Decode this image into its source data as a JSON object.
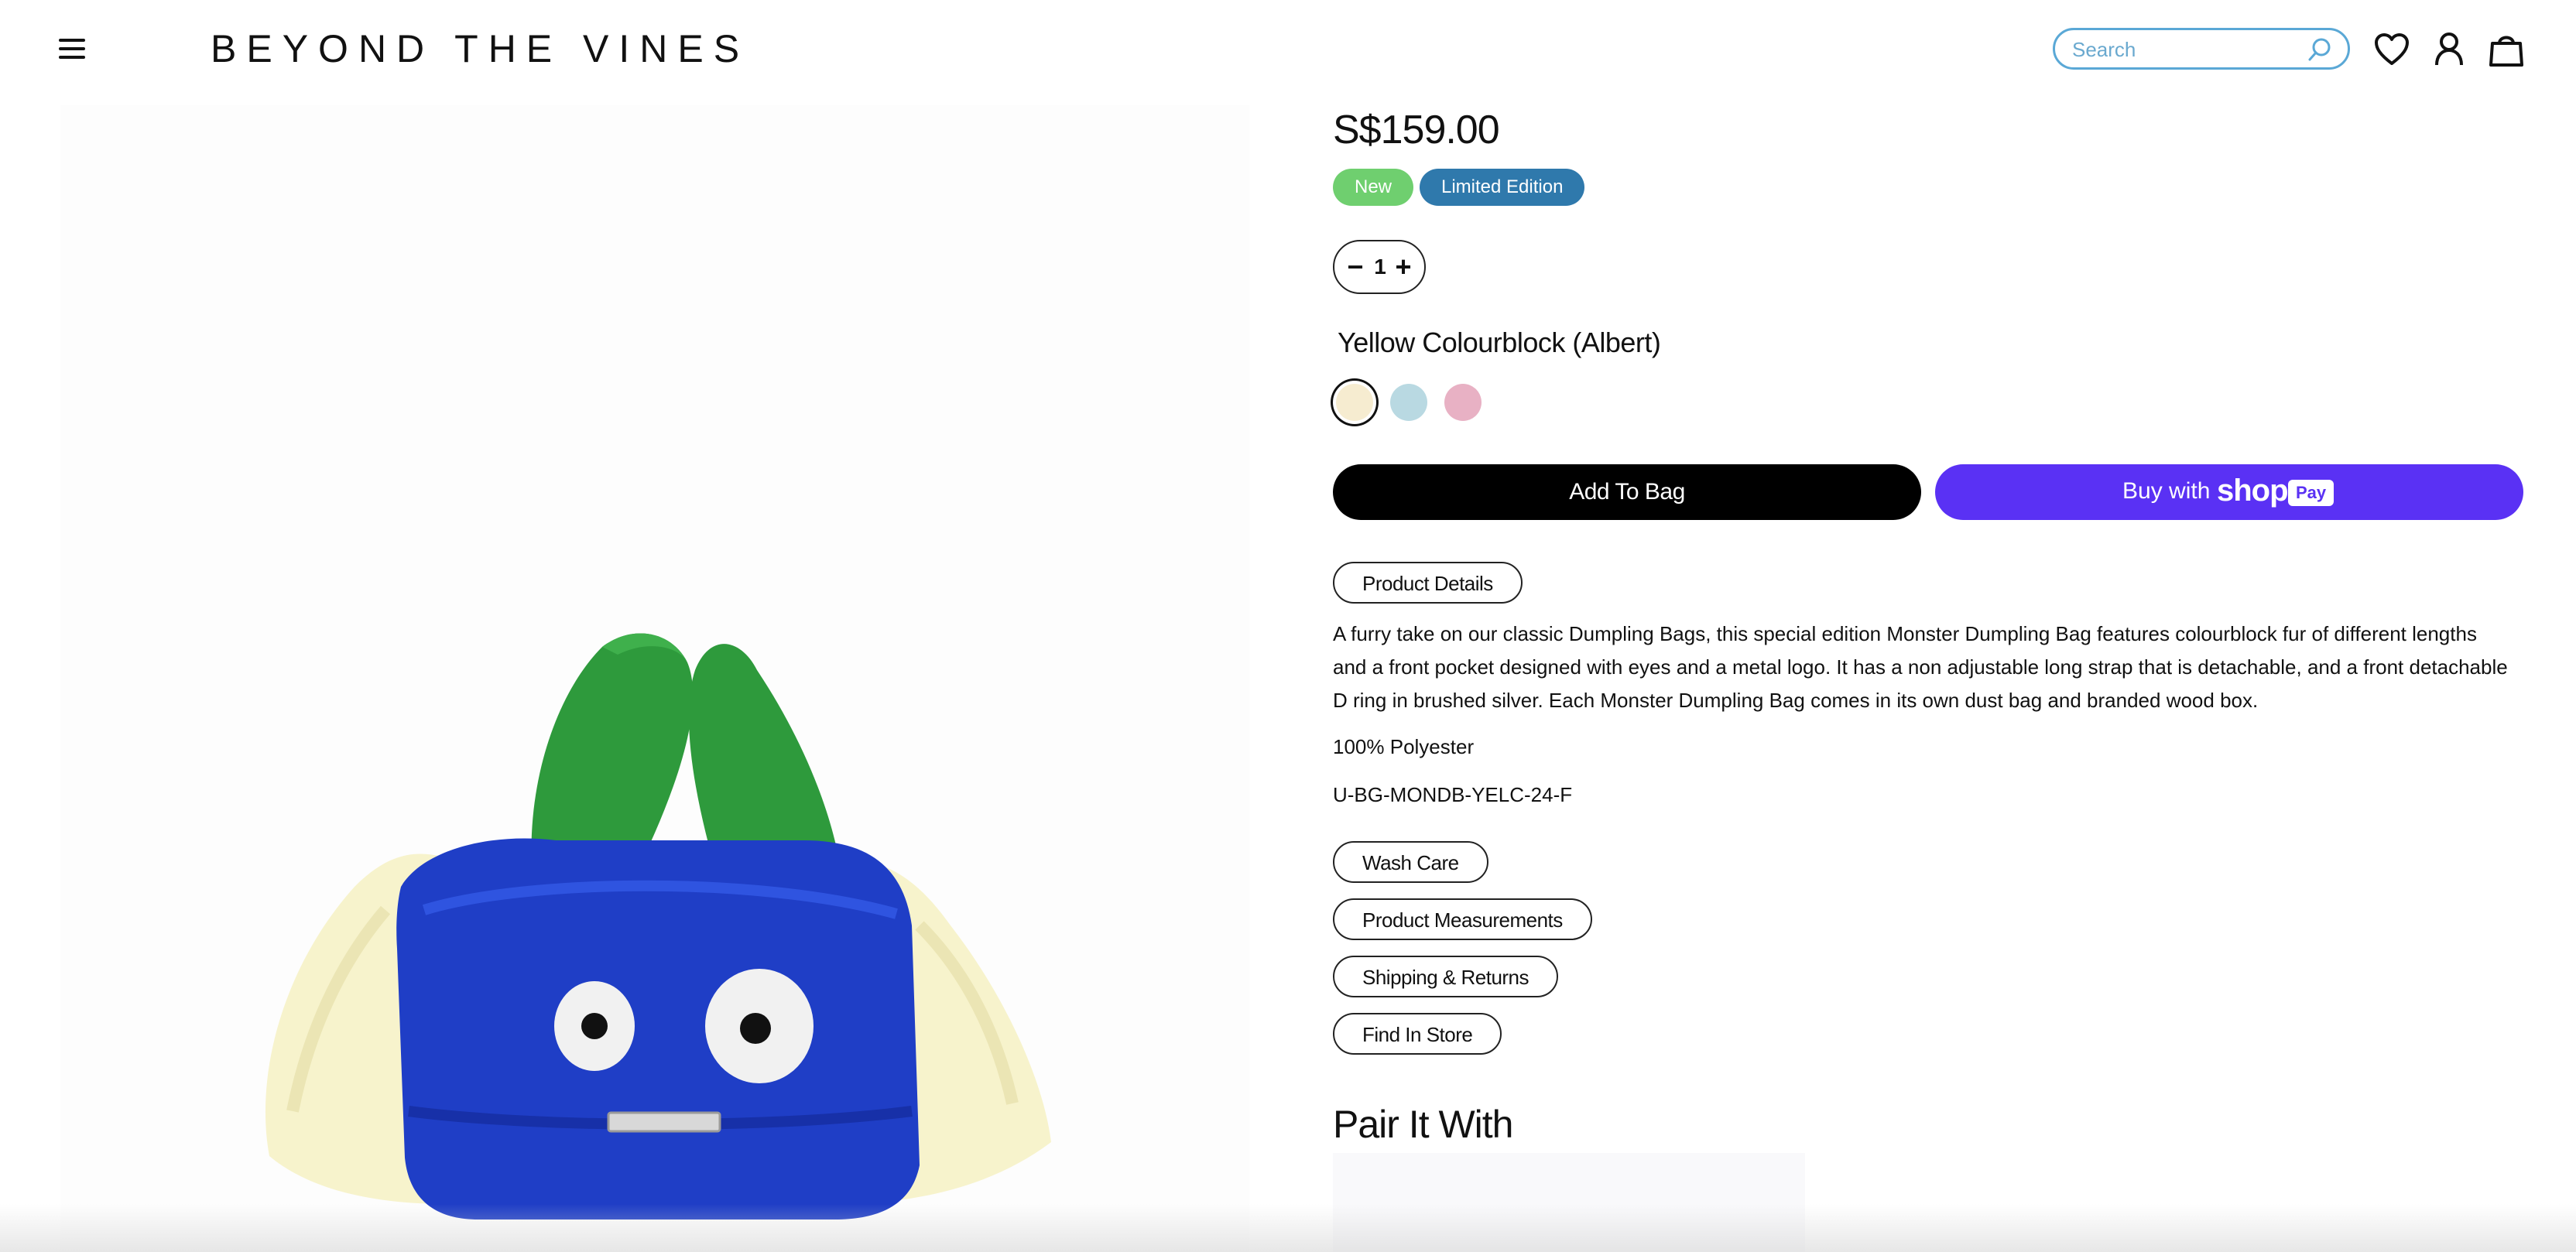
{
  "header": {
    "logo": "BEYOND THE VINES",
    "search_placeholder": "Search",
    "icons": [
      "menu-icon",
      "search-icon",
      "heart-icon",
      "account-icon",
      "bag-icon"
    ]
  },
  "product": {
    "price": "S$159.00",
    "badges": [
      "New",
      "Limited Edition"
    ],
    "quantity": "1",
    "variant_name": "Yellow Colourblock (Albert)",
    "swatches": [
      {
        "color": "#f6ecd0",
        "selected": true
      },
      {
        "color": "#b9d9e2",
        "selected": false
      },
      {
        "color": "#e8b1c4",
        "selected": false
      }
    ],
    "add_to_bag": "Add To Bag",
    "shop_pay": {
      "prefix": "Buy with",
      "brand": "shop",
      "pay": "Pay"
    },
    "details_tab": "Product Details",
    "description": "A furry take on our classic Dumpling Bags, this special edition Monster Dumpling Bag features colourblock fur of different lengths and a front pocket designed with eyes and a metal logo. It has a non adjustable long strap that is detachable, and a front detachable D ring in brushed silver. Each Monster Dumpling Bag comes in its own dust bag and branded wood box.",
    "material": "100% Polyester",
    "sku": "U-BG-MONDB-YELC-24-F",
    "sections": [
      "Wash Care",
      "Product Measurements",
      "Shipping & Returns",
      "Find In Store"
    ],
    "pair_heading": "Pair It With"
  },
  "colors": {
    "accent_search": "#5aa8d6",
    "badge_new": "#6fcf6f",
    "badge_limited": "#2f79ac",
    "shop_pay": "#5a31f4",
    "bag_body": "#1d3fc4",
    "bag_handle": "#2f9a3a",
    "bag_fur": "#f6f1c8"
  }
}
